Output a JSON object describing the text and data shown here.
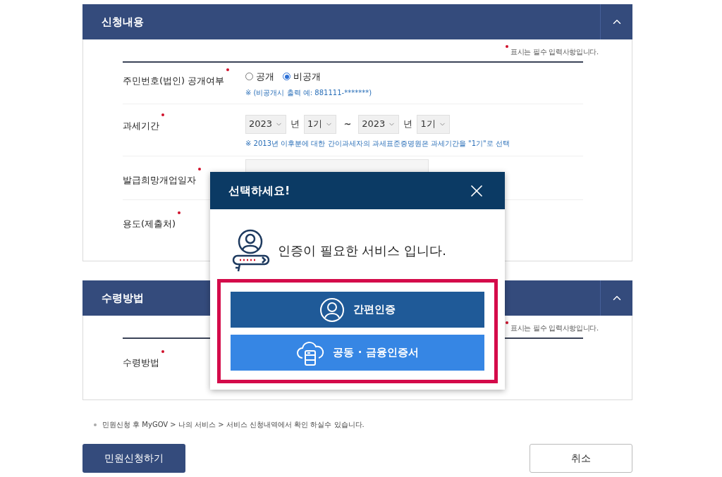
{
  "sections": [
    {
      "title": "신청내용",
      "required_note": "표시는 필수 입력사항입니다.",
      "rows": [
        {
          "kind": "radio",
          "label": "주민번호(법인) 공개여부",
          "required": true,
          "options": [
            {
              "label": "공개",
              "selected": false
            },
            {
              "label": "비공개",
              "selected": true
            }
          ],
          "hint": "※ (비공개시 출력 예: 881111-*******)"
        },
        {
          "kind": "period",
          "label": "과세기간",
          "required": true,
          "from_year": "2023",
          "year_unit": "년",
          "from_term": "1기",
          "separator": "~",
          "to_year": "2023",
          "to_year_unit": "년",
          "to_term": "1기",
          "hint": "※ 2013년 이후분에 대한 간이과세자의 과세표준증명원은 과세기간을 \"1기\"로 선택"
        },
        {
          "kind": "field",
          "label": "발급희망개업일자",
          "required": true
        },
        {
          "kind": "plain",
          "label": "용도(제출처)",
          "required": true
        }
      ]
    },
    {
      "title": "수령방법",
      "required_note": "표시는 필수 입력사항입니다.",
      "rows": [
        {
          "kind": "plain",
          "label": "수령방법",
          "required": true
        }
      ]
    }
  ],
  "note": "민원신청 후 MyGOV > 나의 서비스 > 서비스 신청내역에서 확인 하실수 있습니다.",
  "buttons": {
    "submit": "민원신청하기",
    "cancel": "취소"
  },
  "modal": {
    "title": "선택하세요!",
    "message": "인증이 필요한 서비스 입니다.",
    "options": [
      {
        "kind": "simple",
        "label": "간편인증"
      },
      {
        "kind": "certificate",
        "label": "공동 · 금융인증서"
      }
    ]
  }
}
